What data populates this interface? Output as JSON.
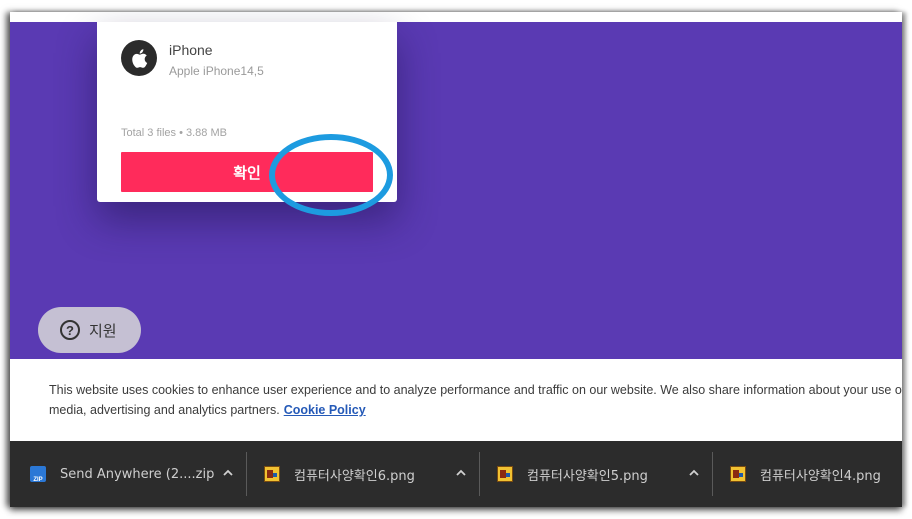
{
  "dialog": {
    "device_name": "iPhone",
    "device_model": "Apple iPhone14,5",
    "total_files": "Total 3 files • 3.88 MB",
    "confirm_label": "확인",
    "device_icon": "apple-icon"
  },
  "support": {
    "label": "지원",
    "icon": "help-circle-icon"
  },
  "cookie_banner": {
    "line1": "This website uses cookies to enhance user experience and to analyze performance and traffic on our website. We also share information about your use of our site with our social",
    "line2": "media, advertising and analytics partners.",
    "policy_link": "Cookie Policy"
  },
  "downloads": [
    {
      "name": "Send Anywhere (2....zip",
      "icon": "zip-file-icon"
    },
    {
      "name": "컴퓨터사양확인6.png",
      "icon": "png-file-icon"
    },
    {
      "name": "컴퓨터사양확인5.png",
      "icon": "png-file-icon"
    },
    {
      "name": "컴퓨터사양확인4.png",
      "icon": "png-file-icon"
    }
  ],
  "colors": {
    "background": "#5a3ab3",
    "confirm_button": "#ff2b5b",
    "highlight_ring": "#1d9be0",
    "cookie_link": "#2459b7",
    "download_bar": "#2c2c2c"
  }
}
